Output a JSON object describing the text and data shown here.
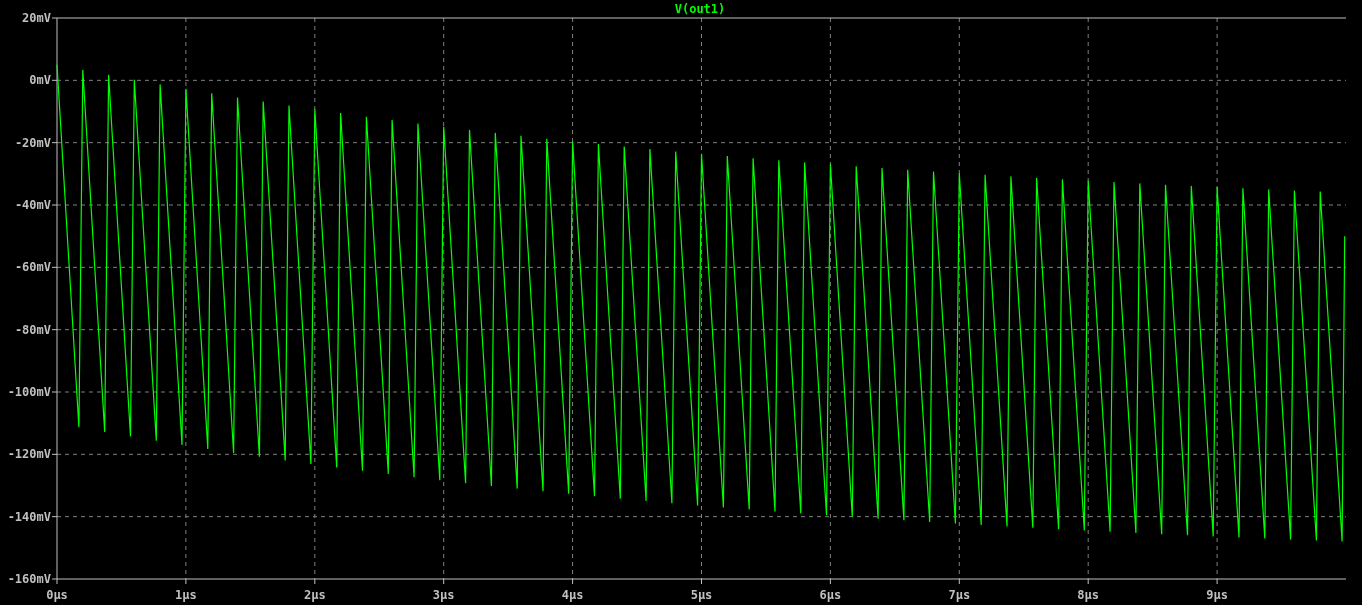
{
  "plot": {
    "trace_label": "V(out1)",
    "y_tick_labels": [
      "20mV",
      "0mV",
      "-20mV",
      "-40mV",
      "-60mV",
      "-80mV",
      "-100mV",
      "-120mV",
      "-140mV",
      "-160mV"
    ],
    "x_tick_labels": [
      "0µs",
      "1µs",
      "2µs",
      "3µs",
      "4µs",
      "5µs",
      "6µs",
      "7µs",
      "8µs",
      "9µs"
    ]
  }
}
